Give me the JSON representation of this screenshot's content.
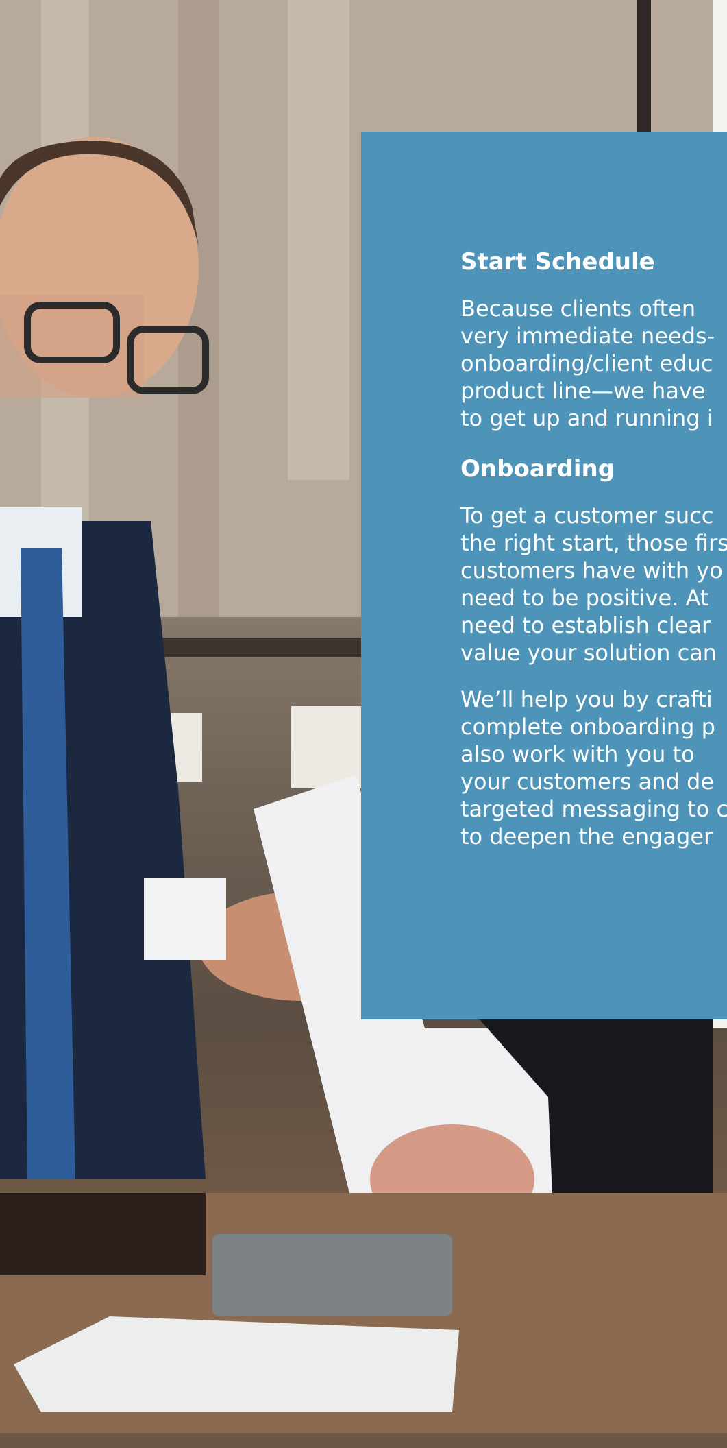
{
  "background_photo": {
    "description_icon": "business-handshake-photo"
  },
  "panel": {
    "background_color": "#4e93b8",
    "sections": [
      {
        "heading": "Start Schedule",
        "paragraphs": [
          {
            "lines": [
              "Because clients often",
              "very immediate needs-",
              "onboarding/client educ",
              "product line—we have",
              "to get up and running i"
            ]
          }
        ]
      },
      {
        "heading": "Onboarding",
        "paragraphs": [
          {
            "lines": [
              "To get a customer succ",
              "the right start, those firs",
              "customers have with yo",
              "need to  be positive. At",
              "need to establish clear",
              "value your solution can"
            ]
          },
          {
            "lines": [
              "We’ll help you by crafti",
              "complete onboarding p",
              "also work with you to",
              "your customers and de",
              "targeted messaging to c",
              "to deepen the engager"
            ]
          }
        ]
      }
    ]
  }
}
